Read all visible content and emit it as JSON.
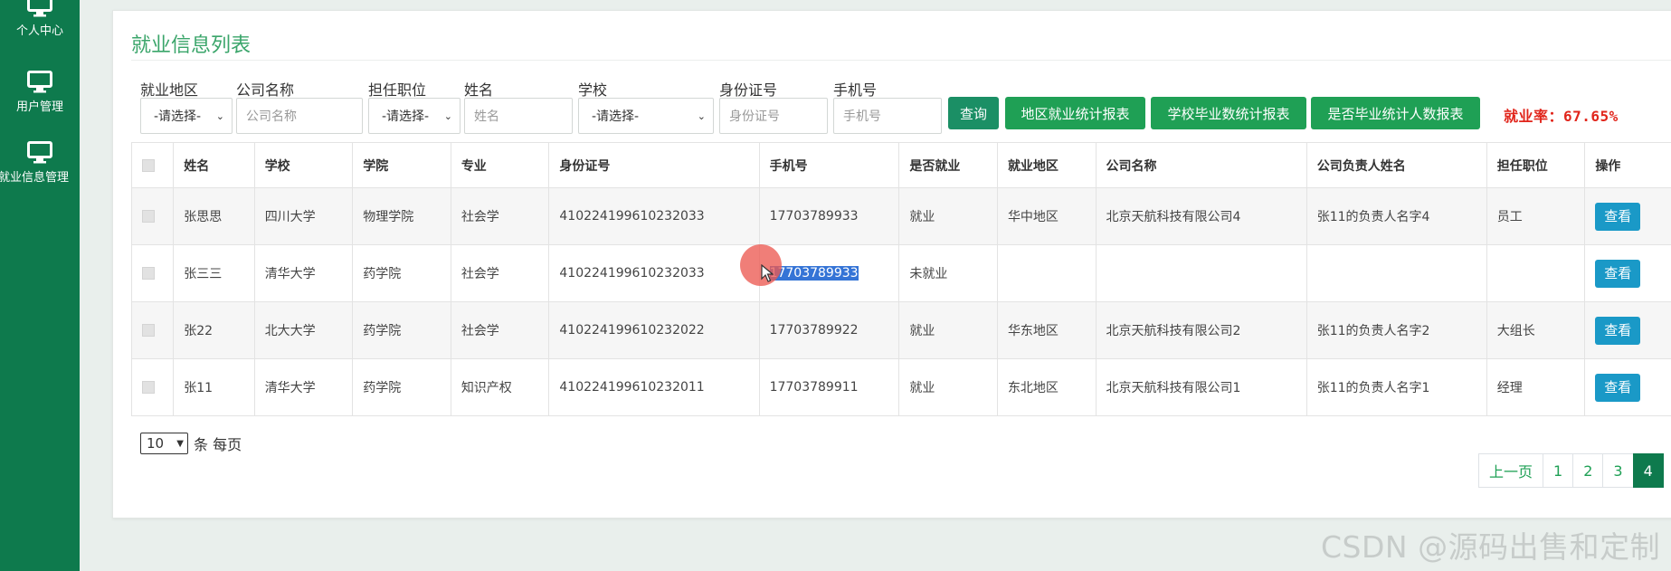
{
  "sidebar": {
    "items": [
      {
        "label": "个人中心"
      },
      {
        "label": "用户管理"
      },
      {
        "label": "就业信息管理"
      }
    ]
  },
  "page": {
    "title": "就业信息列表"
  },
  "filters": {
    "region": {
      "label": "就业地区",
      "value": "-请选择-"
    },
    "company": {
      "label": "公司名称",
      "placeholder": "公司名称"
    },
    "position": {
      "label": "担任职位",
      "value": "-请选择-"
    },
    "name": {
      "label": "姓名",
      "placeholder": "姓名"
    },
    "school": {
      "label": "学校",
      "value": "-请选择-"
    },
    "id_card": {
      "label": "身份证号",
      "placeholder": "身份证号"
    },
    "phone": {
      "label": "手机号",
      "placeholder": "手机号"
    }
  },
  "buttons": {
    "query": "查询",
    "region_report": "地区就业统计报表",
    "school_report": "学校毕业数统计报表",
    "employed_report": "是否毕业统计人数报表"
  },
  "rate": "就业率：67.65%",
  "table": {
    "headers": [
      "姓名",
      "学校",
      "学院",
      "专业",
      "身份证号",
      "手机号",
      "是否就业",
      "就业地区",
      "公司名称",
      "公司负责人姓名",
      "担任职位",
      "操作"
    ],
    "view_label": "查看",
    "rows": [
      {
        "name": "张思思",
        "school": "四川大学",
        "college": "物理学院",
        "major": "社会学",
        "id_card": "410224199610232033",
        "phone": "17703789933",
        "employed": "就业",
        "region": "华中地区",
        "company": "北京天航科技有限公司4",
        "manager": "张11的负责人名字4",
        "position": "员工"
      },
      {
        "name": "张三三",
        "school": "清华大学",
        "college": "药学院",
        "major": "社会学",
        "id_card": "410224199610232033",
        "phone": "17703789933",
        "employed": "未就业",
        "region": "",
        "company": "",
        "manager": "",
        "position": ""
      },
      {
        "name": "张22",
        "school": "北大大学",
        "college": "药学院",
        "major": "社会学",
        "id_card": "410224199610232022",
        "phone": "17703789922",
        "employed": "就业",
        "region": "华东地区",
        "company": "北京天航科技有限公司2",
        "manager": "张11的负责人名字2",
        "position": "大组长"
      },
      {
        "name": "张11",
        "school": "清华大学",
        "college": "药学院",
        "major": "知识产权",
        "id_card": "410224199610232011",
        "phone": "17703789911",
        "employed": "就业",
        "region": "东北地区",
        "company": "北京天航科技有限公司1",
        "manager": "张11的负责人名字1",
        "position": "经理"
      }
    ]
  },
  "page_size": {
    "value": "10",
    "suffix": "条 每页"
  },
  "pagination": {
    "prev": "上一页",
    "pages": [
      "1",
      "2",
      "3",
      "4"
    ],
    "active": "4"
  },
  "watermark": "CSDN @源码出售和定制",
  "colors": {
    "sidebar": "#0e7a4d",
    "accent": "#1fa055",
    "title": "#3aa56a",
    "rate": "#e1251b",
    "view_button": "#1a99c7"
  }
}
